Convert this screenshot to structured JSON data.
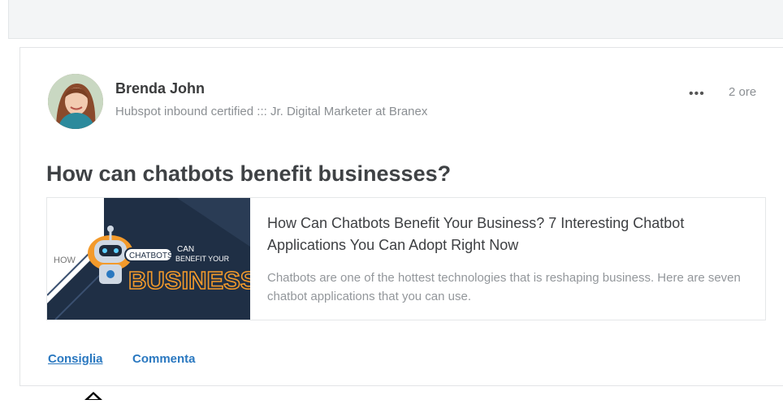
{
  "post": {
    "author_name": "Brenda John",
    "author_headline": "Hubspot inbound certified ::: Jr. Digital Marketer at Branex",
    "more_glyph": "•••",
    "time": "2 ore",
    "title": "How can chatbots benefit businesses?",
    "link": {
      "title": "How Can Chatbots Benefit Your Business? 7 Interesting Chatbot Applications You Can Adopt Right Now",
      "description": "Chatbots are one of the hottest technologies that is reshaping business. Here are seven chatbot applications that you can use.",
      "thumbnail": {
        "how": "HOW",
        "chatbots": "CHATBOTS",
        "can": "CAN",
        "benefit": "BENEFIT YOUR",
        "business": "BUSINESS?"
      }
    },
    "actions": {
      "like": "Consiglia",
      "comment": "Commenta"
    }
  },
  "colors": {
    "link_blue": "#2a78c0",
    "thumb_navy": "#1f2f45",
    "thumb_orange": "#f39a2b"
  },
  "icons": {
    "more": "more-dots-icon",
    "cursor": "mouse-pointer-icon"
  }
}
